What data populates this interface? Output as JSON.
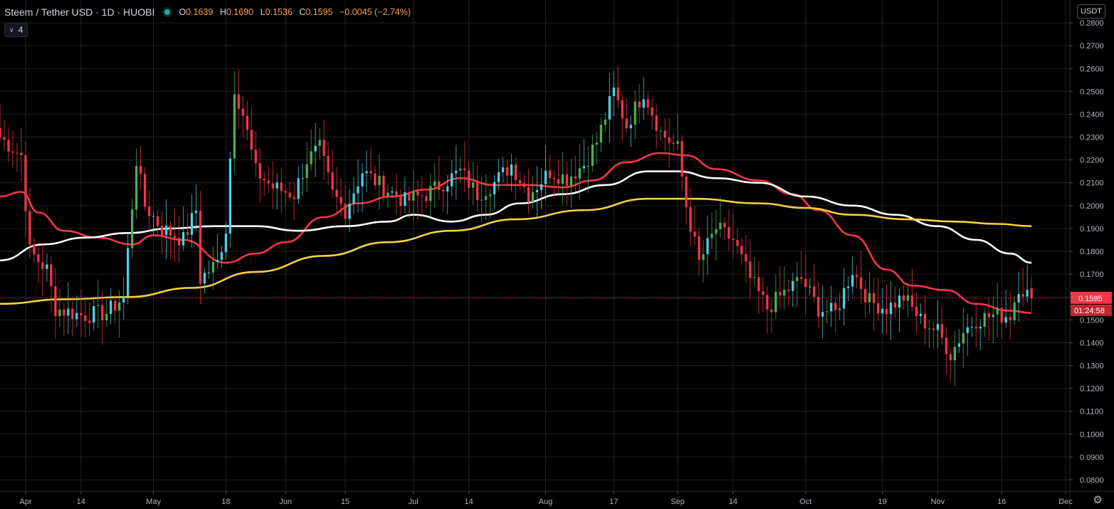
{
  "header": {
    "symbol": "Steem / Tether USD · 1D · HUOBI",
    "open_label": "O",
    "open": "0.1639",
    "high_label": "H",
    "high": "0.1690",
    "low_label": "L",
    "low": "0.1536",
    "close_label": "C",
    "close": "0.1595",
    "change": "−0.0045 (−2.74%)"
  },
  "indicator_toggle": {
    "label": "4",
    "icon": "chevron-down-icon"
  },
  "unit_badge": "USDT",
  "settings_icon": "gear-icon",
  "colors": {
    "up": "#4caf50",
    "up_alt": "#4dd0e1",
    "down": "#f23645",
    "ma_fast": "#f23645",
    "ma_mid": "#ffffff",
    "ma_slow": "#f5d13f",
    "price_line": "#f23645",
    "grid": "#1f2229",
    "axis_text": "#b2b5be"
  },
  "chart_data": {
    "type": "candlestick",
    "y_axis": {
      "min": 0.075,
      "max": 0.29,
      "ticks": [
        "0.0800",
        "0.0900",
        "0.1000",
        "0.1100",
        "0.1200",
        "0.1300",
        "0.1400",
        "0.1500",
        "0.1600",
        "0.1700",
        "0.1800",
        "0.1900",
        "0.2000",
        "0.2100",
        "0.2200",
        "0.2300",
        "0.2400",
        "0.2500",
        "0.2600",
        "0.2700",
        "0.2800"
      ],
      "tick_values": [
        0.08,
        0.09,
        0.1,
        0.11,
        0.12,
        0.13,
        0.14,
        0.15,
        0.16,
        0.17,
        0.18,
        0.19,
        0.2,
        0.21,
        0.22,
        0.23,
        0.24,
        0.25,
        0.26,
        0.27,
        0.28
      ]
    },
    "x_axis": {
      "start": "2020-03-26",
      "end": "2020-12-02",
      "labels": [
        {
          "text": "Apr",
          "date": "2020-04-01"
        },
        {
          "text": "14",
          "date": "2020-04-14"
        },
        {
          "text": "May",
          "date": "2020-05-01"
        },
        {
          "text": "18",
          "date": "2020-05-18"
        },
        {
          "text": "Jun",
          "date": "2020-06-01"
        },
        {
          "text": "15",
          "date": "2020-06-15"
        },
        {
          "text": "Jul",
          "date": "2020-07-01"
        },
        {
          "text": "14",
          "date": "2020-07-14"
        },
        {
          "text": "Aug",
          "date": "2020-08-01"
        },
        {
          "text": "17",
          "date": "2020-08-17"
        },
        {
          "text": "Sep",
          "date": "2020-09-01"
        },
        {
          "text": "14",
          "date": "2020-09-14"
        },
        {
          "text": "Oct",
          "date": "2020-10-01"
        },
        {
          "text": "19",
          "date": "2020-10-19"
        },
        {
          "text": "Nov",
          "date": "2020-11-01"
        },
        {
          "text": "16",
          "date": "2020-11-16"
        },
        {
          "text": "Dec",
          "date": "2020-12-01"
        }
      ]
    },
    "last_price": {
      "value": 0.1595,
      "label": "0.1595",
      "countdown": "01:24:58"
    },
    "ohlc_anchors": [
      {
        "date": "2020-03-26",
        "close": 0.23
      },
      {
        "date": "2020-03-31",
        "close": 0.222
      },
      {
        "date": "2020-04-02",
        "close": 0.18
      },
      {
        "date": "2020-04-06",
        "close": 0.172
      },
      {
        "date": "2020-04-08",
        "close": 0.155
      },
      {
        "date": "2020-04-14",
        "close": 0.152
      },
      {
        "date": "2020-04-20",
        "close": 0.153
      },
      {
        "date": "2020-04-24",
        "close": 0.16
      },
      {
        "date": "2020-04-27",
        "close": 0.22
      },
      {
        "date": "2020-04-29",
        "close": 0.2
      },
      {
        "date": "2020-05-03",
        "close": 0.19
      },
      {
        "date": "2020-05-08",
        "close": 0.185
      },
      {
        "date": "2020-05-11",
        "close": 0.198
      },
      {
        "date": "2020-05-12",
        "close": 0.168
      },
      {
        "date": "2020-05-16",
        "close": 0.175
      },
      {
        "date": "2020-05-18",
        "close": 0.19
      },
      {
        "date": "2020-05-20",
        "close": 0.252
      },
      {
        "date": "2020-05-22",
        "close": 0.24
      },
      {
        "date": "2020-05-25",
        "close": 0.215
      },
      {
        "date": "2020-05-29",
        "close": 0.208
      },
      {
        "date": "2020-06-03",
        "close": 0.205
      },
      {
        "date": "2020-06-06",
        "close": 0.22
      },
      {
        "date": "2020-06-09",
        "close": 0.225
      },
      {
        "date": "2020-06-12",
        "close": 0.205
      },
      {
        "date": "2020-06-15",
        "close": 0.198
      },
      {
        "date": "2020-06-19",
        "close": 0.215
      },
      {
        "date": "2020-06-24",
        "close": 0.208
      },
      {
        "date": "2020-06-29",
        "close": 0.202
      },
      {
        "date": "2020-07-04",
        "close": 0.205
      },
      {
        "date": "2020-07-08",
        "close": 0.21
      },
      {
        "date": "2020-07-12",
        "close": 0.215
      },
      {
        "date": "2020-07-16",
        "close": 0.205
      },
      {
        "date": "2020-07-20",
        "close": 0.21
      },
      {
        "date": "2020-07-24",
        "close": 0.218
      },
      {
        "date": "2020-07-28",
        "close": 0.205
      },
      {
        "date": "2020-08-02",
        "close": 0.215
      },
      {
        "date": "2020-08-06",
        "close": 0.212
      },
      {
        "date": "2020-08-10",
        "close": 0.218
      },
      {
        "date": "2020-08-13",
        "close": 0.228
      },
      {
        "date": "2020-08-17",
        "close": 0.25
      },
      {
        "date": "2020-08-20",
        "close": 0.235
      },
      {
        "date": "2020-08-24",
        "close": 0.25
      },
      {
        "date": "2020-08-28",
        "close": 0.232
      },
      {
        "date": "2020-09-01",
        "close": 0.225
      },
      {
        "date": "2020-09-03",
        "close": 0.2
      },
      {
        "date": "2020-09-06",
        "close": 0.175
      },
      {
        "date": "2020-09-10",
        "close": 0.19
      },
      {
        "date": "2020-09-14",
        "close": 0.185
      },
      {
        "date": "2020-09-18",
        "close": 0.168
      },
      {
        "date": "2020-09-22",
        "close": 0.155
      },
      {
        "date": "2020-09-26",
        "close": 0.162
      },
      {
        "date": "2020-09-30",
        "close": 0.168
      },
      {
        "date": "2020-10-04",
        "close": 0.155
      },
      {
        "date": "2020-10-08",
        "close": 0.153
      },
      {
        "date": "2020-10-12",
        "close": 0.172
      },
      {
        "date": "2020-10-16",
        "close": 0.158
      },
      {
        "date": "2020-10-20",
        "close": 0.155
      },
      {
        "date": "2020-10-24",
        "close": 0.16
      },
      {
        "date": "2020-10-28",
        "close": 0.15
      },
      {
        "date": "2020-11-01",
        "close": 0.145
      },
      {
        "date": "2020-11-04",
        "close": 0.135
      },
      {
        "date": "2020-11-07",
        "close": 0.145
      },
      {
        "date": "2020-11-10",
        "close": 0.15
      },
      {
        "date": "2020-11-14",
        "close": 0.152
      },
      {
        "date": "2020-11-18",
        "close": 0.152
      },
      {
        "date": "2020-11-20",
        "close": 0.165
      },
      {
        "date": "2020-11-23",
        "close": 0.1595
      }
    ],
    "moving_averages": [
      {
        "color": "#f23645",
        "points": [
          [
            "2020-03-26",
            0.204
          ],
          [
            "2020-03-31",
            0.206
          ],
          [
            "2020-04-04",
            0.197
          ],
          [
            "2020-04-10",
            0.189
          ],
          [
            "2020-04-18",
            0.186
          ],
          [
            "2020-04-26",
            0.183
          ],
          [
            "2020-05-01",
            0.187
          ],
          [
            "2020-05-08",
            0.185
          ],
          [
            "2020-05-18",
            0.175
          ],
          [
            "2020-05-25",
            0.179
          ],
          [
            "2020-06-01",
            0.184
          ],
          [
            "2020-06-10",
            0.195
          ],
          [
            "2020-06-18",
            0.201
          ],
          [
            "2020-06-26",
            0.204
          ],
          [
            "2020-07-04",
            0.207
          ],
          [
            "2020-07-12",
            0.212
          ],
          [
            "2020-07-20",
            0.209
          ],
          [
            "2020-07-28",
            0.209
          ],
          [
            "2020-08-05",
            0.208
          ],
          [
            "2020-08-12",
            0.211
          ],
          [
            "2020-08-20",
            0.219
          ],
          [
            "2020-08-28",
            0.223
          ],
          [
            "2020-09-03",
            0.222
          ],
          [
            "2020-09-10",
            0.216
          ],
          [
            "2020-09-20",
            0.211
          ],
          [
            "2020-09-28",
            0.205
          ],
          [
            "2020-10-04",
            0.198
          ],
          [
            "2020-10-12",
            0.187
          ],
          [
            "2020-10-20",
            0.172
          ],
          [
            "2020-10-26",
            0.165
          ],
          [
            "2020-11-03",
            0.163
          ],
          [
            "2020-11-10",
            0.157
          ],
          [
            "2020-11-18",
            0.154
          ],
          [
            "2020-11-23",
            0.153
          ]
        ]
      },
      {
        "color": "#ffffff",
        "points": [
          [
            "2020-03-26",
            0.176
          ],
          [
            "2020-04-05",
            0.183
          ],
          [
            "2020-04-15",
            0.186
          ],
          [
            "2020-04-25",
            0.188
          ],
          [
            "2020-05-05",
            0.19
          ],
          [
            "2020-05-15",
            0.191
          ],
          [
            "2020-05-25",
            0.191
          ],
          [
            "2020-06-04",
            0.189
          ],
          [
            "2020-06-15",
            0.191
          ],
          [
            "2020-06-25",
            0.193
          ],
          [
            "2020-07-01",
            0.196
          ],
          [
            "2020-07-10",
            0.193
          ],
          [
            "2020-07-18",
            0.196
          ],
          [
            "2020-07-26",
            0.201
          ],
          [
            "2020-08-05",
            0.205
          ],
          [
            "2020-08-15",
            0.209
          ],
          [
            "2020-08-25",
            0.215
          ],
          [
            "2020-09-01",
            0.215
          ],
          [
            "2020-09-10",
            0.212
          ],
          [
            "2020-09-20",
            0.21
          ],
          [
            "2020-10-01",
            0.204
          ],
          [
            "2020-10-12",
            0.2
          ],
          [
            "2020-10-22",
            0.196
          ],
          [
            "2020-11-01",
            0.191
          ],
          [
            "2020-11-10",
            0.185
          ],
          [
            "2020-11-18",
            0.179
          ],
          [
            "2020-11-23",
            0.175
          ]
        ]
      },
      {
        "color": "#f5d13f",
        "points": [
          [
            "2020-03-26",
            0.157
          ],
          [
            "2020-04-10",
            0.159
          ],
          [
            "2020-04-25",
            0.16
          ],
          [
            "2020-05-10",
            0.164
          ],
          [
            "2020-05-25",
            0.171
          ],
          [
            "2020-06-10",
            0.178
          ],
          [
            "2020-06-25",
            0.184
          ],
          [
            "2020-07-10",
            0.189
          ],
          [
            "2020-07-25",
            0.194
          ],
          [
            "2020-08-10",
            0.198
          ],
          [
            "2020-08-25",
            0.203
          ],
          [
            "2020-09-05",
            0.203
          ],
          [
            "2020-09-20",
            0.201
          ],
          [
            "2020-10-01",
            0.199
          ],
          [
            "2020-10-12",
            0.196
          ],
          [
            "2020-10-25",
            0.194
          ],
          [
            "2020-11-05",
            0.193
          ],
          [
            "2020-11-15",
            0.192
          ],
          [
            "2020-11-23",
            0.191
          ]
        ]
      }
    ]
  }
}
